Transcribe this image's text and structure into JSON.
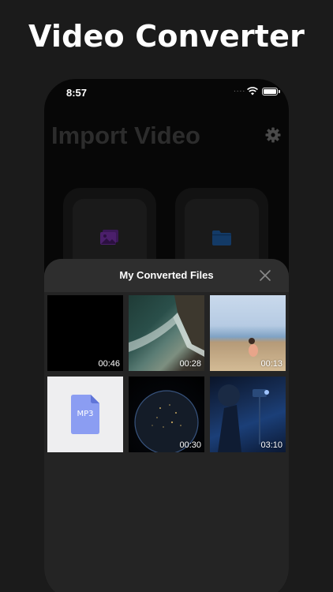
{
  "headline": "Video Converter",
  "status_bar": {
    "time": "8:57",
    "dots": "...."
  },
  "import_screen": {
    "title": "Import Video"
  },
  "sheet": {
    "title": "My Converted Files",
    "items": [
      {
        "kind": "video",
        "duration": "00:46"
      },
      {
        "kind": "video",
        "duration": "00:28"
      },
      {
        "kind": "video",
        "duration": "00:13"
      },
      {
        "kind": "audio",
        "label": "MP3"
      },
      {
        "kind": "video",
        "duration": "00:30"
      },
      {
        "kind": "video",
        "duration": "03:10"
      }
    ]
  },
  "icons": {
    "gear": "gear-icon",
    "close": "close-icon",
    "photos": "photos-icon",
    "folder": "folder-icon",
    "wifi": "wifi-icon",
    "battery": "battery-icon",
    "audio_file": "audio-file-icon"
  },
  "colors": {
    "background": "#1b1b1b",
    "phone_background": "#070707",
    "sheet_background": "#242424",
    "photos_accent": "#4b1f6b",
    "folder_accent": "#133a66",
    "mp3_file": "#8b9df2"
  }
}
